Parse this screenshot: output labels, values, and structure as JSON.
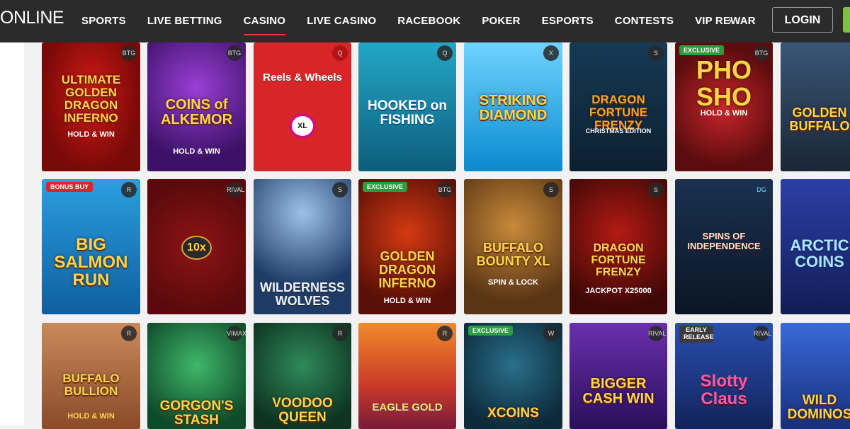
{
  "header": {
    "logo": "ONLINE",
    "nav": [
      {
        "label": "SPORTS",
        "active": false
      },
      {
        "label": "LIVE BETTING",
        "active": false
      },
      {
        "label": "CASINO",
        "active": true
      },
      {
        "label": "LIVE CASINO",
        "active": false
      },
      {
        "label": "RACEBOOK",
        "active": false
      },
      {
        "label": "POKER",
        "active": false
      },
      {
        "label": "ESPORTS",
        "active": false
      },
      {
        "label": "CONTESTS",
        "active": false
      },
      {
        "label": "VIP REWARD",
        "active": false
      }
    ],
    "more_icon": "›",
    "login_label": "LOGIN",
    "colors": {
      "bar": "#2b2b2b",
      "active_underline": "#e23a2f",
      "join_green": "#7dc242"
    }
  },
  "games": [
    {
      "title": "ULTIMATE GOLDEN DRAGON INFERNO",
      "sub": "HOLD & WIN",
      "badge": "",
      "provider": "BTG"
    },
    {
      "title": "COINS of ALKEMOR",
      "sub": "HOLD & WIN",
      "badge": "",
      "provider": "BTG"
    },
    {
      "title": "Reels & Wheels",
      "sub": "XL",
      "badge": "",
      "provider": "Q"
    },
    {
      "title": "HOOKED on FISHING",
      "sub": "",
      "badge": "",
      "provider": "Q"
    },
    {
      "title": "STRIKING DIAMOND",
      "sub": "",
      "badge": "",
      "provider": "X"
    },
    {
      "title": "DRAGON FORTUNE FRENZY",
      "sub": "CHRISTMAS EDITION",
      "badge": "",
      "provider": "S"
    },
    {
      "title": "PHO SHO",
      "sub": "HOLD & WIN",
      "badge": "EXCLUSIVE",
      "provider": "BTG"
    },
    {
      "title": "GOLDEN BUFFALO",
      "sub": "",
      "badge": "",
      "provider": ""
    },
    {
      "title": "BIG SALMON RUN",
      "sub": "",
      "badge": "BONUS BUY",
      "provider": "R"
    },
    {
      "title": "10x",
      "sub": "",
      "badge": "",
      "provider": "RIVAL"
    },
    {
      "title": "WILDERNESS WOLVES",
      "sub": "",
      "badge": "",
      "provider": "S"
    },
    {
      "title": "GOLDEN DRAGON INFERNO",
      "sub": "HOLD & WIN",
      "badge": "EXCLUSIVE",
      "provider": "BTG"
    },
    {
      "title": "BUFFALO BOUNTY XL",
      "sub": "SPIN & LOCK",
      "badge": "",
      "provider": "S"
    },
    {
      "title": "DRAGON FORTUNE FRENZY",
      "sub": "JACKPOT X25000",
      "badge": "",
      "provider": "S"
    },
    {
      "title": "SPINS OF INDEPENDENCE",
      "sub": "",
      "badge": "",
      "provider": "DG"
    },
    {
      "title": "ARCTIC COINS",
      "sub": "",
      "badge": "",
      "provider": ""
    },
    {
      "title": "BUFFALO BULLION",
      "sub": "HOLD & WIN",
      "badge": "",
      "provider": "R"
    },
    {
      "title": "GORGON'S STASH",
      "sub": "",
      "badge": "",
      "provider": "VIMAX"
    },
    {
      "title": "VOODOO QUEEN",
      "sub": "",
      "badge": "",
      "provider": "R"
    },
    {
      "title": "EAGLE GOLD",
      "sub": "",
      "badge": "",
      "provider": "R"
    },
    {
      "title": "XCOINS",
      "sub": "",
      "badge": "EXCLUSIVE",
      "provider": "W"
    },
    {
      "title": "BIGGER CASH WIN",
      "sub": "",
      "badge": "",
      "provider": "RIVAL"
    },
    {
      "title": "Slotty Claus",
      "sub": "",
      "badge": "EARLY RELEASE",
      "provider": "RIVAL"
    },
    {
      "title": "WILD DOMINOS",
      "sub": "",
      "badge": "",
      "provider": ""
    }
  ]
}
